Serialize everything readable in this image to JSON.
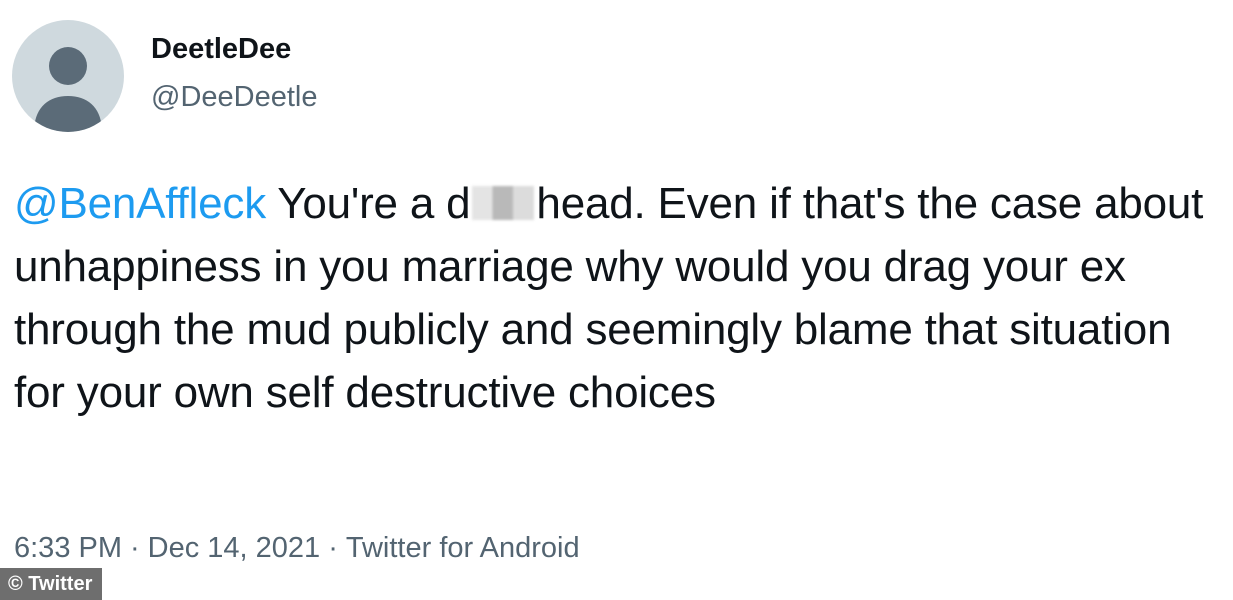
{
  "tweet": {
    "display_name": "DeetleDee",
    "handle": "@DeeDeetle",
    "mention": "@BenAffleck",
    "text_part1": "You're a d",
    "text_part2": "head.  Even if that's the case about unhappiness in you marriage why would you drag your ex through the mud publicly and seemingly blame that situation for your own self destructive choices",
    "time": "6:33 PM",
    "date": "Dec 14, 2021",
    "source": "Twitter for Android",
    "separator": "·"
  },
  "watermark": "© Twitter",
  "colors": {
    "mention_blue": "#1d9bf0",
    "text": "#0f1419",
    "secondary": "#536471",
    "avatar_bg": "#cfd9de",
    "avatar_fg": "#5b6b78"
  },
  "icons": {
    "avatar": "default-profile-icon"
  }
}
